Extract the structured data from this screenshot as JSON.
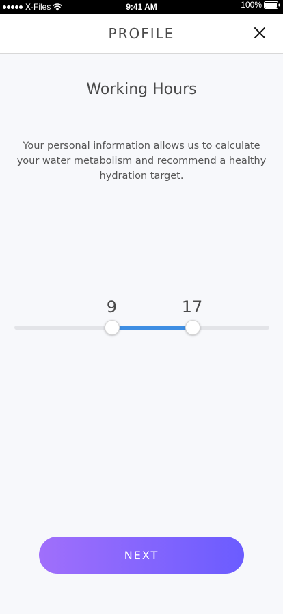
{
  "status_bar": {
    "carrier": "X-Files",
    "time": "9:41 AM",
    "battery": "100%",
    "signal_icon": "signal-dots-icon",
    "wifi_icon": "wifi-icon",
    "battery_icon": "battery-icon"
  },
  "header": {
    "title": "PROFILE",
    "close_icon": "close-icon"
  },
  "content": {
    "title": "Working Hours",
    "description": "Your personal information allows us to calculate your water metabolism and recommend a healthy hydration target."
  },
  "slider": {
    "min": 0,
    "max": 24,
    "start_value": "9",
    "end_value": "17",
    "start": 9,
    "end": 17,
    "accent_color": "#3e8ee3",
    "track_color": "#e3e4e8"
  },
  "footer": {
    "next_label": "NEXT",
    "gradient_start": "#a06ffb",
    "gradient_end": "#6b5cff"
  }
}
